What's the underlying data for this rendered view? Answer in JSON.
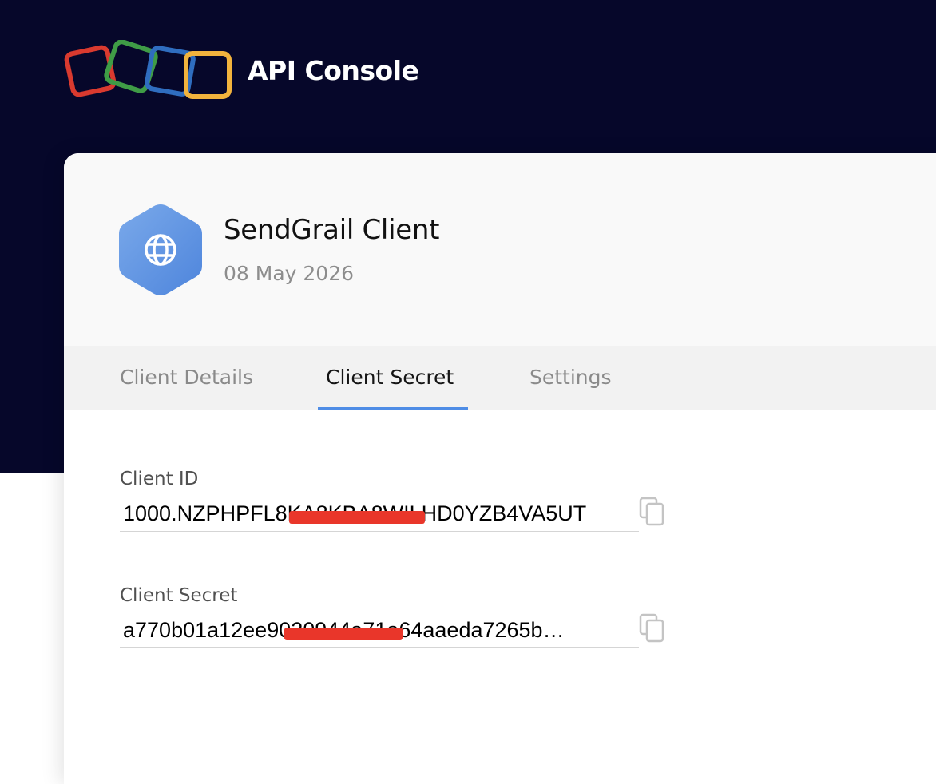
{
  "header": {
    "title": "API Console",
    "logo_colors": [
      "#d93a2f",
      "#3f9c46",
      "#2f6dbf",
      "#f2b33d"
    ]
  },
  "app": {
    "name": "SendGrail Client",
    "date": "08 May 2026",
    "icon": "globe-icon",
    "icon_color": "#5b93df"
  },
  "tabs": [
    {
      "label": "Client Details",
      "active": false
    },
    {
      "label": "Client Secret",
      "active": true
    },
    {
      "label": "Settings",
      "active": false
    }
  ],
  "fields": {
    "client_id": {
      "label": "Client ID",
      "value": "1000.NZPHPFL8KA8KBA8WILHD0YZB4VA5UT",
      "copy_icon": "copy-icon"
    },
    "client_secret": {
      "label": "Client Secret",
      "value": "a770b01a12ee9020944a71a64aaeda7265b…",
      "copy_icon": "copy-icon"
    }
  },
  "colors": {
    "header_bg": "#06072a",
    "accent": "#4f8de6",
    "redaction": "#e9362a"
  }
}
